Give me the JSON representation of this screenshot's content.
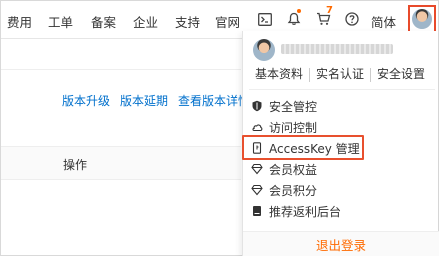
{
  "topnav": {
    "items": [
      "费用",
      "工单",
      "备案",
      "企业",
      "支持",
      "官网"
    ],
    "cart_badge": "7",
    "lang": "简体",
    "icons": [
      "terminal-icon",
      "bell-icon",
      "cart-icon",
      "help-icon"
    ]
  },
  "page": {
    "links": [
      "版本升级",
      "版本延期",
      "查看版本详情"
    ],
    "column_header": "操作"
  },
  "dropdown": {
    "tabs": [
      "基本资料",
      "实名认证",
      "安全设置"
    ],
    "menu": [
      "安全管控",
      "访问控制",
      "AccessKey 管理",
      "会员权益",
      "会员积分",
      "推荐返利后台"
    ],
    "logout": "退出登录"
  },
  "colors": {
    "accent": "#ff6a00",
    "link": "#0070cc",
    "highlight_border": "#e8502e"
  }
}
